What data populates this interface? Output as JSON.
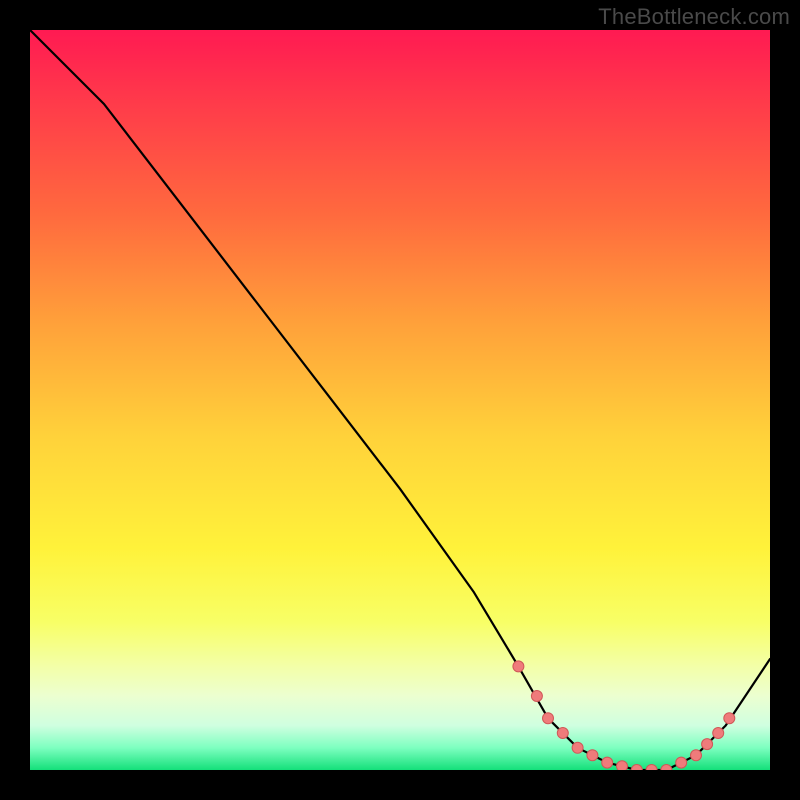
{
  "attribution": "TheBottleneck.com",
  "chart_data": {
    "type": "line",
    "title": "",
    "xlabel": "",
    "ylabel": "",
    "xlim": [
      0,
      100
    ],
    "ylim": [
      0,
      100
    ],
    "series": [
      {
        "name": "bottleneck-curve",
        "x": [
          0,
          5,
          10,
          20,
          30,
          40,
          50,
          60,
          66,
          70,
          74,
          78,
          82,
          86,
          90,
          94,
          100
        ],
        "y": [
          100,
          95,
          90,
          77,
          64,
          51,
          38,
          24,
          14,
          7,
          3,
          1,
          0,
          0,
          2,
          6,
          15
        ]
      },
      {
        "name": "highlight-dots",
        "x": [
          66,
          68.5,
          70,
          72,
          74,
          76,
          78,
          80,
          82,
          84,
          86,
          88,
          90,
          91.5,
          93,
          94.5
        ],
        "y": [
          14,
          10,
          7,
          5,
          3,
          2,
          1,
          0.5,
          0,
          0,
          0,
          1,
          2,
          3.5,
          5,
          7
        ]
      }
    ],
    "colors": {
      "line": "#000000",
      "dot_fill": "#ef7b7b",
      "dot_stroke": "#d05858",
      "gradient_top": "#ff1a52",
      "gradient_bottom": "#14e07a"
    }
  }
}
